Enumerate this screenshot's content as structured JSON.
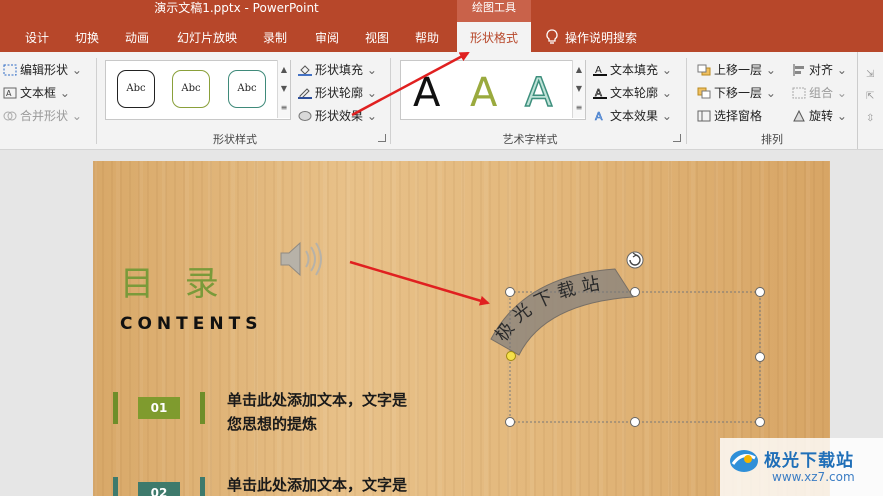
{
  "window": {
    "title": "演示文稿1.pptx  -  PowerPoint",
    "context_tab_group": "绘图工具"
  },
  "tabs": [
    "设计",
    "切换",
    "动画",
    "幻灯片放映",
    "录制",
    "审阅",
    "视图",
    "帮助"
  ],
  "active_tab": "形状格式",
  "tell_me": "操作说明搜索",
  "ribbon": {
    "insert_shapes": {
      "edit_shape": "编辑形状",
      "text_box": "文本框",
      "merge_shapes": "合并形状"
    },
    "shape_styles": {
      "sample_text": "Abc",
      "fill": "形状填充",
      "outline": "形状轮廓",
      "effects": "形状效果",
      "label": "形状样式"
    },
    "wordart": {
      "sample_letter": "A",
      "text_fill": "文本填充",
      "text_outline": "文本轮廓",
      "text_effects": "文本效果",
      "label": "艺术字样式"
    },
    "arrange": {
      "bring_forward": "上移一层",
      "send_backward": "下移一层",
      "selection_pane": "选择窗格",
      "align": "对齐",
      "group": "组合",
      "rotate": "旋转",
      "label": "排列"
    }
  },
  "slide": {
    "heading": "目 录",
    "subheading": "CONTENTS",
    "items": [
      {
        "num": "01",
        "text_line1": "单击此处添加文本，文字是",
        "text_line2": "您思想的提炼"
      },
      {
        "num": "02",
        "text_line1": "单击此处添加文本，文字是",
        "text_line2": ""
      }
    ],
    "arc_text": "极光下载站"
  },
  "watermark": {
    "name": "极光下载站",
    "url": "www.xz7.com"
  },
  "colors": {
    "title_bar": "#b7472a",
    "ribbon_bg": "#f3f3f3",
    "heading_green": "#7a9a3a",
    "number_green": "#7f9b2e",
    "bracket_green": "#6e8e2a",
    "annotation_arrow": "#e02020"
  }
}
